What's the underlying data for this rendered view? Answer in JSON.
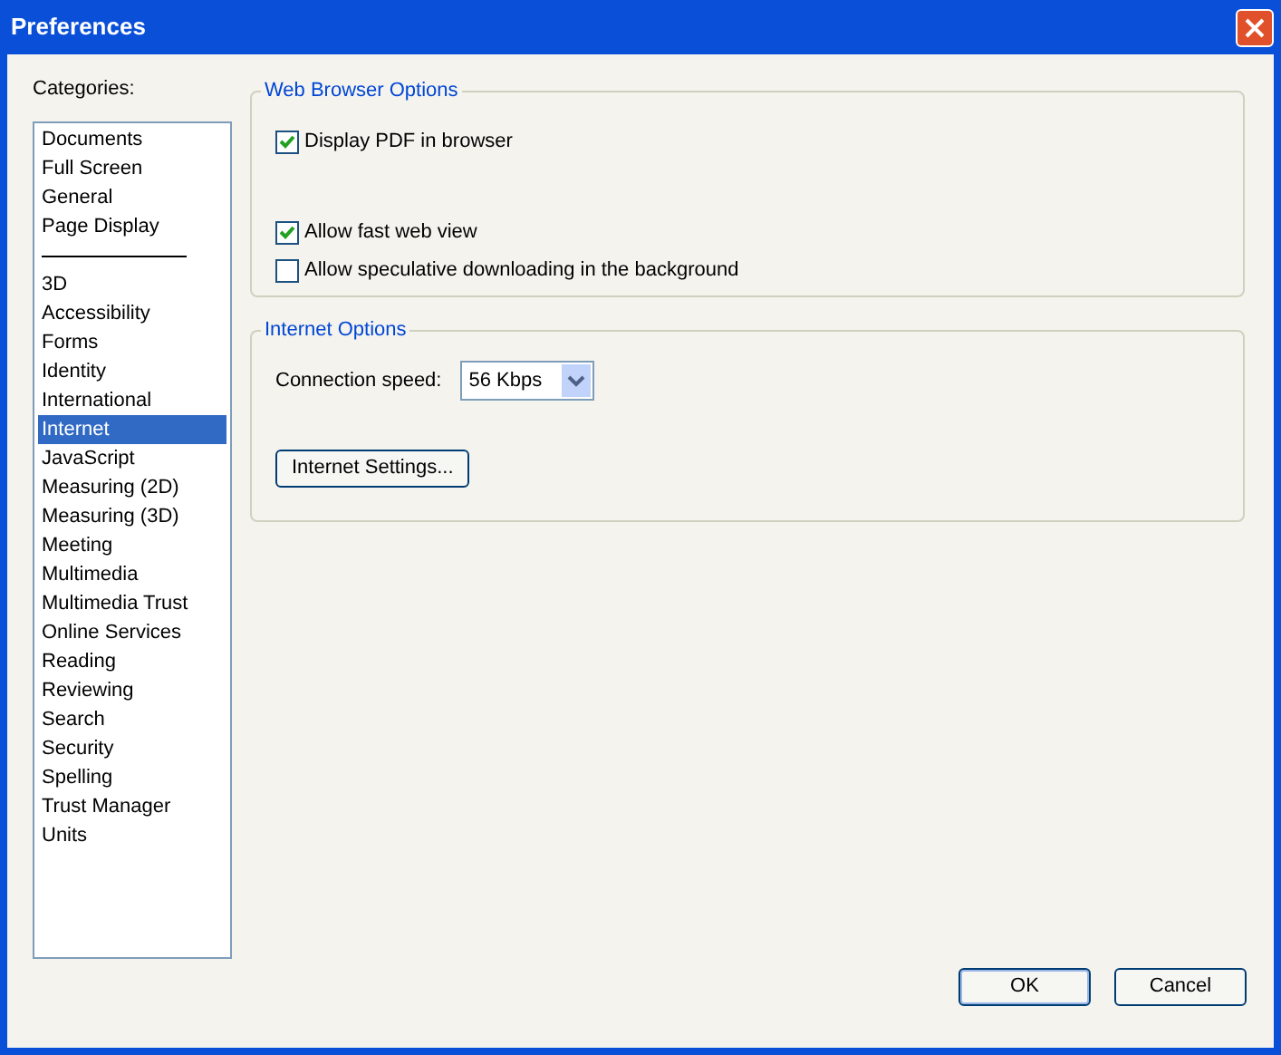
{
  "window": {
    "title": "Preferences"
  },
  "categories": {
    "label": "Categories:",
    "items": [
      {
        "kind": "item",
        "label": "Documents",
        "selected": false
      },
      {
        "kind": "item",
        "label": "Full Screen",
        "selected": false
      },
      {
        "kind": "item",
        "label": "General",
        "selected": false
      },
      {
        "kind": "item",
        "label": "Page Display",
        "selected": false
      },
      {
        "kind": "separator"
      },
      {
        "kind": "item",
        "label": "3D",
        "selected": false
      },
      {
        "kind": "item",
        "label": "Accessibility",
        "selected": false
      },
      {
        "kind": "item",
        "label": "Forms",
        "selected": false
      },
      {
        "kind": "item",
        "label": "Identity",
        "selected": false
      },
      {
        "kind": "item",
        "label": "International",
        "selected": false
      },
      {
        "kind": "item",
        "label": "Internet",
        "selected": true
      },
      {
        "kind": "item",
        "label": "JavaScript",
        "selected": false
      },
      {
        "kind": "item",
        "label": "Measuring (2D)",
        "selected": false
      },
      {
        "kind": "item",
        "label": "Measuring (3D)",
        "selected": false
      },
      {
        "kind": "item",
        "label": "Meeting",
        "selected": false
      },
      {
        "kind": "item",
        "label": "Multimedia",
        "selected": false
      },
      {
        "kind": "item",
        "label": "Multimedia Trust",
        "selected": false
      },
      {
        "kind": "item",
        "label": "Online Services",
        "selected": false
      },
      {
        "kind": "item",
        "label": "Reading",
        "selected": false
      },
      {
        "kind": "item",
        "label": "Reviewing",
        "selected": false
      },
      {
        "kind": "item",
        "label": "Search",
        "selected": false
      },
      {
        "kind": "item",
        "label": "Security",
        "selected": false
      },
      {
        "kind": "item",
        "label": "Spelling",
        "selected": false
      },
      {
        "kind": "item",
        "label": "Trust Manager",
        "selected": false
      },
      {
        "kind": "item",
        "label": "Units",
        "selected": false
      }
    ]
  },
  "web_browser_options": {
    "title": "Web Browser Options",
    "options": [
      {
        "label": "Display PDF in browser",
        "checked": true
      },
      {
        "label": "Allow fast web view",
        "checked": true
      },
      {
        "label": "Allow speculative downloading in the background",
        "checked": false
      }
    ]
  },
  "internet_options": {
    "title": "Internet Options",
    "connection_speed": {
      "label": "Connection speed:",
      "value": "56 Kbps"
    },
    "settings_button": "Internet Settings..."
  },
  "buttons": [
    "OK",
    "Cancel"
  ]
}
